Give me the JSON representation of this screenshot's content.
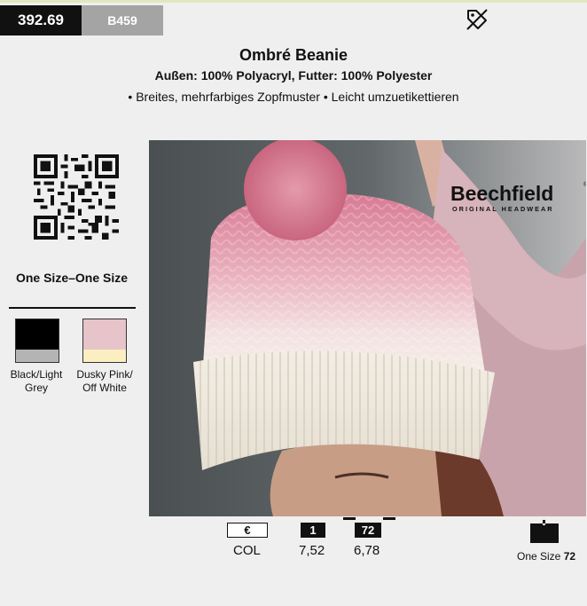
{
  "header": {
    "article_number": "392.69",
    "brand_code": "B459",
    "tag_icon": "price-tag-off-icon"
  },
  "product": {
    "title": "Ombré Beanie",
    "material": "Außen: 100% Polyacryl, Futter: 100% Polyester",
    "features": "• Breites, mehrfarbiges Zopfmuster • Leicht umzuetikettieren"
  },
  "sizes": {
    "label": "One Size–One Size"
  },
  "colors": [
    {
      "label": "Black/Light Grey",
      "top": "#000000",
      "bottom": "#b4b4b4"
    },
    {
      "label": "Dusky Pink/ Off White",
      "top": "#e7c4c9",
      "bottom": "#fbefc2"
    }
  ],
  "image": {
    "logo_text": "Beechfield",
    "logo_sub": "ORIGINAL HEADWEAR",
    "trademark": "®"
  },
  "pricing": {
    "currency_label": "€",
    "qty_1_label": "1",
    "qty_72_label": "72",
    "col_label": "COL",
    "price_1": "7,52",
    "price_72": "6,78"
  },
  "packaging": {
    "text": "One Size",
    "qty": "72",
    "icon": "carton-box-icon"
  }
}
